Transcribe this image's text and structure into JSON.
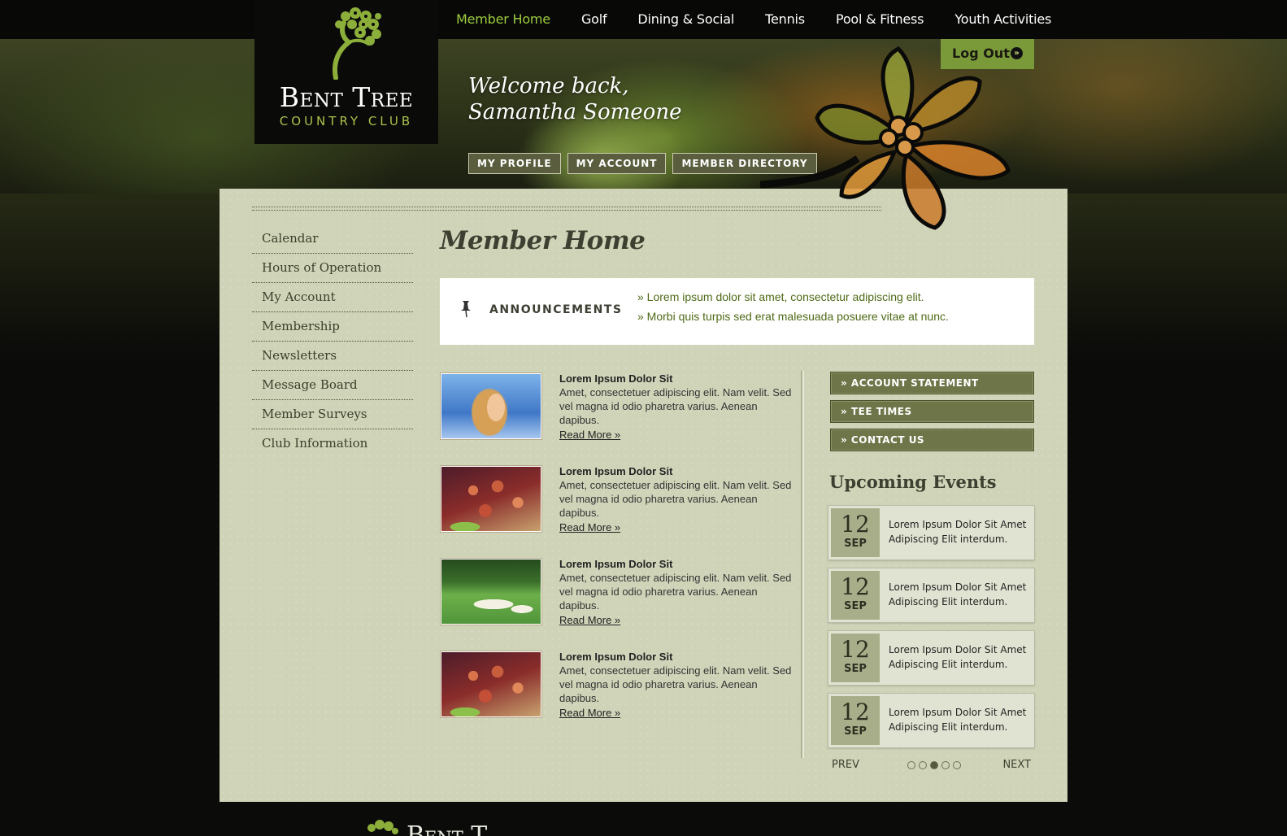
{
  "colors": {
    "brand_green": "#9ccc3c",
    "panel_bg": "#cfd4b8",
    "header_bg": "#080807",
    "button_olive": "#6e7548",
    "logout_green": "#7a9a3a"
  },
  "nav": {
    "items": [
      "Member Home",
      "Golf",
      "Dining & Social",
      "Tennis",
      "Pool & Fitness",
      "Youth Activities"
    ],
    "active": "Member Home"
  },
  "logout": {
    "label": "Log Out",
    "icon": "double-chevron-right-icon"
  },
  "logo": {
    "name": "Bent Tree",
    "subtitle": "COUNTRY CLUB",
    "icon": "tree-icon"
  },
  "welcome": {
    "line1": "Welcome back,",
    "line2": "Samantha Someone"
  },
  "sub_nav": [
    "MY PROFILE",
    "MY ACCOUNT",
    "MEMBER DIRECTORY"
  ],
  "sidebar": {
    "items": [
      "Calendar",
      "Hours of Operation",
      "My Account",
      "Membership",
      "Newsletters",
      "Message Board",
      "Member Surveys",
      "Club Information"
    ]
  },
  "page_title": "Member Home",
  "announcements": {
    "title": "ANNOUNCEMENTS",
    "icon": "pushpin-icon",
    "items": [
      "» Lorem ipsum dolor sit amet, consectetur adipiscing elit.",
      "» Morbi quis turpis sed erat malesuada posuere vitae at nunc."
    ]
  },
  "news": [
    {
      "thumb": "girl-photo",
      "title": "Lorem Ipsum Dolor Sit",
      "body": "Amet, consectetuer adipiscing elit. Nam velit. Sed vel magna id odio pharetra varius. Aenean dapibus.",
      "more": "Read More »"
    },
    {
      "thumb": "food-photo",
      "title": "Lorem Ipsum Dolor Sit",
      "body": "Amet, consectetuer adipiscing elit. Nam velit. Sed vel magna id odio pharetra varius. Aenean dapibus.",
      "more": "Read More »"
    },
    {
      "thumb": "golf-course-photo",
      "title": "Lorem Ipsum Dolor Sit",
      "body": "Amet, consectetuer adipiscing elit. Nam velit. Sed vel magna id odio pharetra varius. Aenean dapibus.",
      "more": "Read More »"
    },
    {
      "thumb": "food-photo",
      "title": "Lorem Ipsum Dolor Sit",
      "body": "Amet, consectetuer adipiscing elit. Nam velit. Sed vel magna id odio pharetra varius. Aenean dapibus.",
      "more": "Read More »"
    }
  ],
  "quick_links": [
    "» ACCOUNT STATEMENT",
    "» TEE TIMES",
    "» CONTACT US"
  ],
  "events": {
    "title": "Upcoming Events",
    "items": [
      {
        "day": "12",
        "month": "SEP",
        "text": "Lorem Ipsum Dolor Sit Amet Adipiscing Elit interdum."
      },
      {
        "day": "12",
        "month": "SEP",
        "text": "Lorem Ipsum Dolor Sit Amet Adipiscing Elit interdum."
      },
      {
        "day": "12",
        "month": "SEP",
        "text": "Lorem Ipsum Dolor Sit Amet Adipiscing Elit interdum."
      },
      {
        "day": "12",
        "month": "SEP",
        "text": "Lorem Ipsum Dolor Sit Amet Adipiscing Elit interdum."
      }
    ],
    "pager": {
      "prev": "PREV",
      "next": "NEXT",
      "pages": 5,
      "current": 3
    }
  },
  "footer": {
    "name": "Bent T"
  }
}
